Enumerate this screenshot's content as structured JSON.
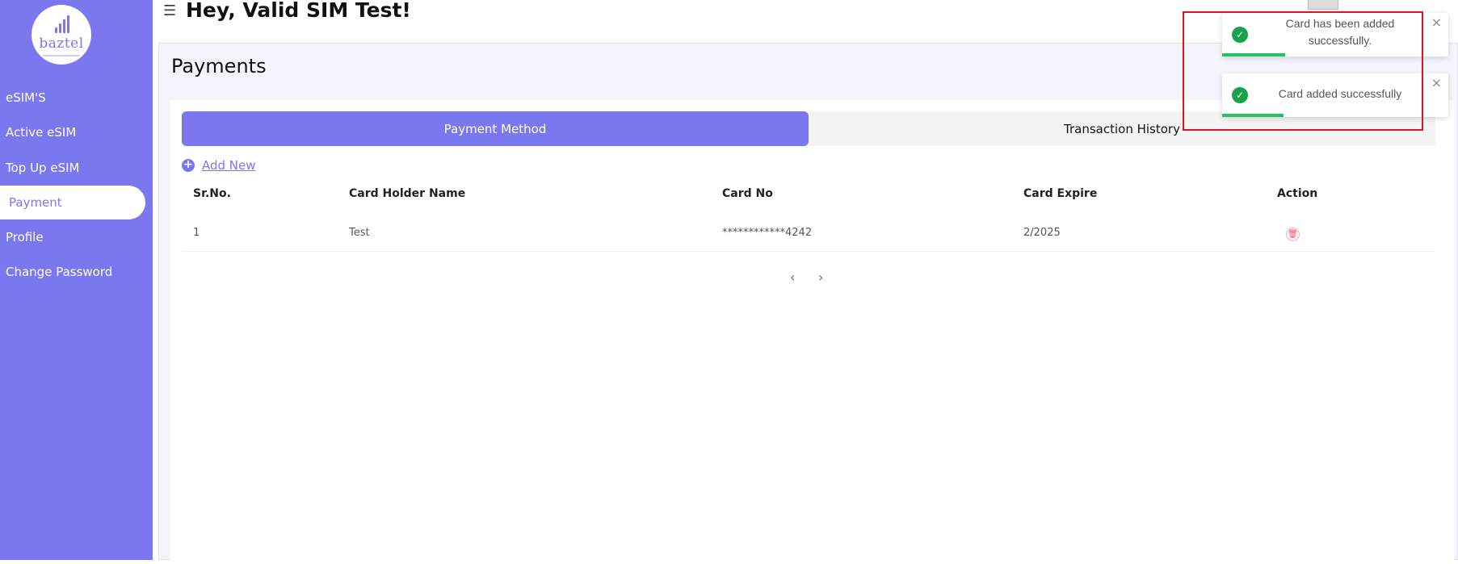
{
  "sidebar": {
    "logo_text": "baztel",
    "items": [
      {
        "label": "eSIM'S"
      },
      {
        "label": "Active eSIM"
      },
      {
        "label": "Top Up eSIM"
      },
      {
        "label": "Payment",
        "active": true
      },
      {
        "label": "Profile"
      },
      {
        "label": "Change Password"
      }
    ]
  },
  "header": {
    "menu_icon": "hamburger-icon",
    "greeting": "Hey, Valid SIM Test!"
  },
  "main": {
    "title": "Payments",
    "tabs": [
      {
        "label": "Payment Method",
        "active": true
      },
      {
        "label": "Transaction History",
        "active": false
      }
    ],
    "add_new": {
      "label": "Add New",
      "icon": "plus-circle-icon"
    },
    "table": {
      "columns": [
        "Sr.No.",
        "Card Holder Name",
        "Card No",
        "Card Expire",
        "Action"
      ],
      "rows": [
        {
          "sr": "1",
          "holder": "Test",
          "card_no": "************4242",
          "expire": "2/2025",
          "action_icon": "trash-icon"
        }
      ]
    },
    "pagination": {
      "prev_icon": "chevron-left-icon",
      "next_icon": "chevron-right-icon"
    }
  },
  "toasts": [
    {
      "message": "Card has been added successfully.",
      "progress": 0.3
    },
    {
      "message": "Card added successfully",
      "progress": 0.3
    }
  ],
  "colors": {
    "accent": "#7b77ee",
    "success": "#22c55e",
    "highlight": "#e3121b"
  }
}
